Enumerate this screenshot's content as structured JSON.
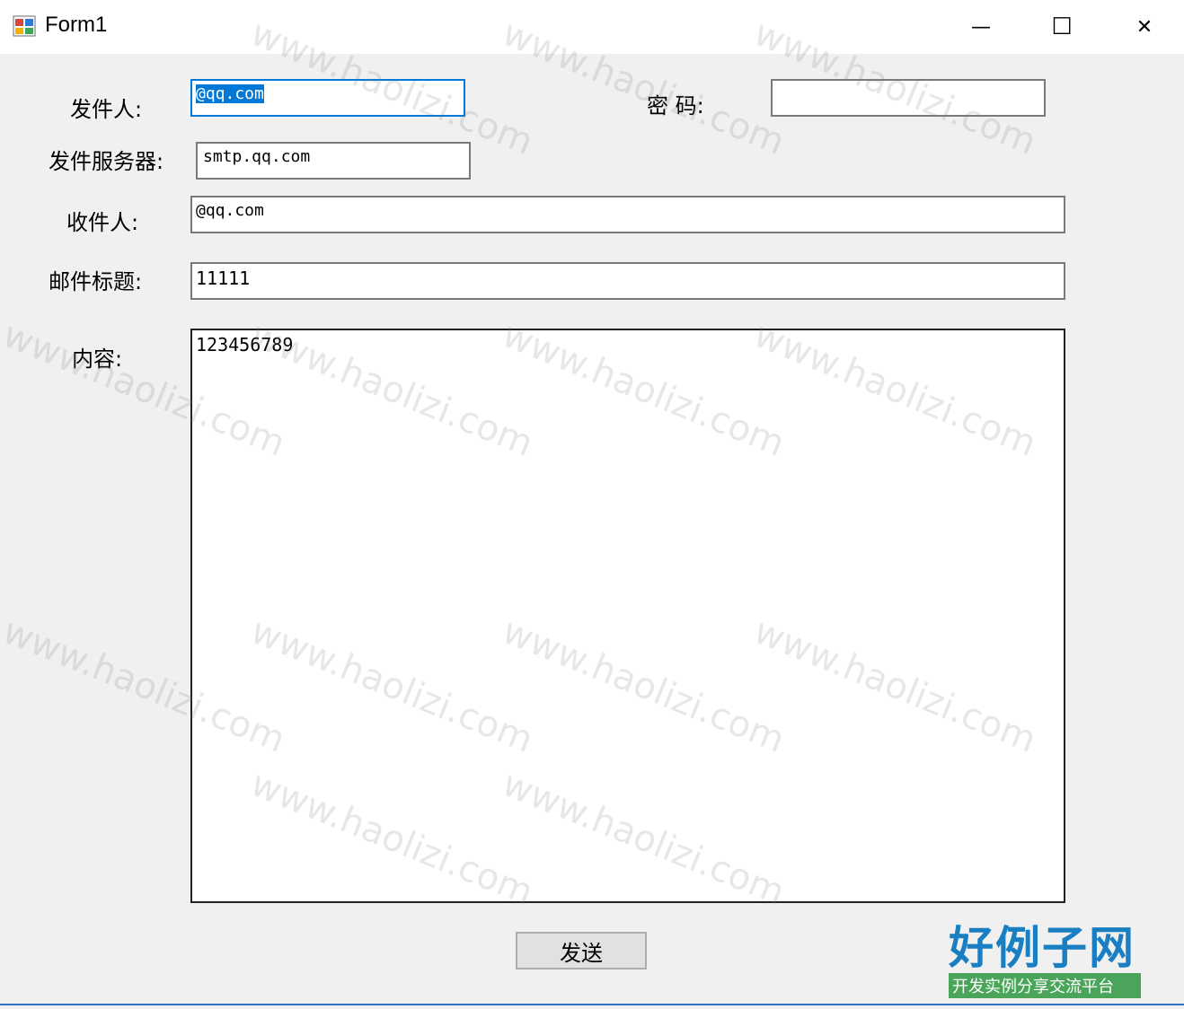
{
  "window": {
    "title": "Form1",
    "minimize_glyph": "—",
    "maximize_glyph": "☐",
    "close_glyph": "✕"
  },
  "form": {
    "sender_label": "发件人:",
    "sender_value": "@qq.com",
    "password_label": "密 码:",
    "password_value": "",
    "server_label": "发件服务器:",
    "server_value": "smtp.qq.com",
    "recipient_label": "收件人:",
    "recipient_value": "@qq.com",
    "subject_label": "邮件标题:",
    "subject_value": "11111",
    "content_label": "内容:",
    "content_value": "123456789",
    "send_label": "发送"
  },
  "watermark": {
    "text": "www.haolizi.com"
  },
  "logo": {
    "main": "好例子网",
    "sub": "开发实例分享交流平台"
  },
  "colors": {
    "accent": "#0078d7",
    "logo_blue": "#1a7fc2",
    "logo_green": "#4aa55a"
  }
}
